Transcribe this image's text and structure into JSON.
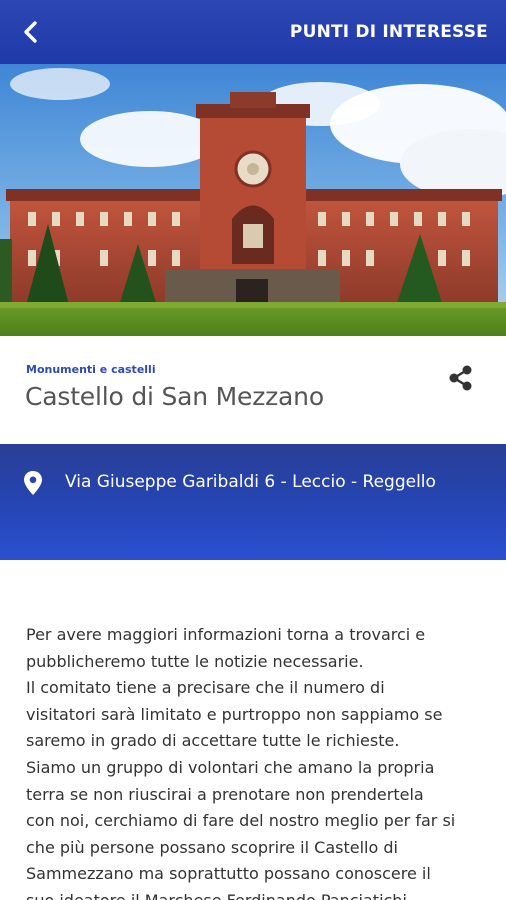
{
  "header": {
    "title": "PUNTI DI INTERESSE",
    "back_icon": "chevron-left-icon",
    "background": "#2544b0"
  },
  "poi": {
    "category": "Monumenti e castelli",
    "title": "Castello di San Mezzano",
    "share_icon": "share-icon",
    "address_icon": "map-pin-icon",
    "address": "Via Giuseppe Garibaldi 6 - Leccio - Reggello",
    "description": "Per avere maggiori informazioni torna a trovarci e\npubblicheremo tutte le notizie necessarie.\nIl comitato tiene a precisare che il numero di\nvisitatori sarà limitato e purtroppo non sappiamo se\nsaremo in grado di accettare tutte le richieste.\nSiamo un gruppo di volontari che amano la propria\nterra se non riuscirai a prenotare non prendertela\ncon noi, cerchiamo di fare del nostro meglio per far si\nche più persone possano scoprire il Castello di\nSammezzano ma soprattutto possano conoscere il\nsuo ideatore il Marchese Ferdinando Panciatichi"
  },
  "colors": {
    "accent": "#2d4ab8",
    "band_top": "#2a3f96",
    "band_bottom": "#2a4fd0",
    "title_text": "#555555"
  }
}
